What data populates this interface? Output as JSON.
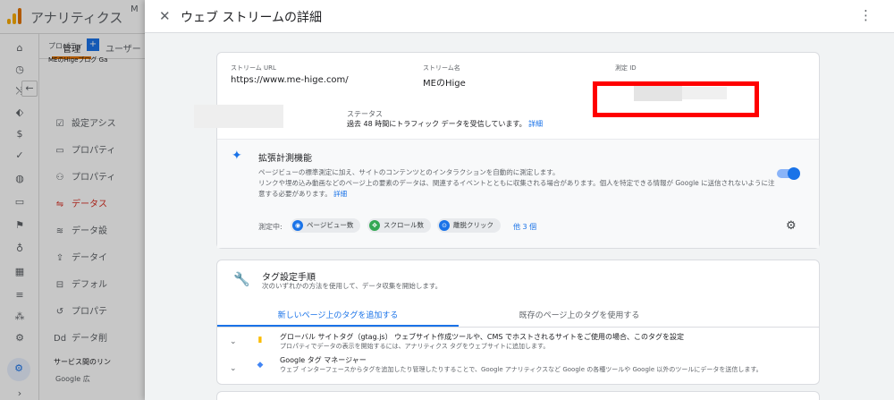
{
  "app": {
    "title": "アナリティクス",
    "account_initial": "M"
  },
  "admin": {
    "tabs": [
      "管理",
      "ユーザー"
    ],
    "property_label": "プロパティ",
    "property_add": "+",
    "property_name": "MEのHigeブログ Ga",
    "items": [
      {
        "icon": "☑",
        "label": "設定アシス"
      },
      {
        "icon": "▭",
        "label": "プロパティ"
      },
      {
        "icon": "⚇",
        "label": "プロパティ"
      },
      {
        "icon": "⇋",
        "label": "データス"
      },
      {
        "icon": "≋",
        "label": "データ設"
      },
      {
        "icon": "⇪",
        "label": "データイ"
      },
      {
        "icon": "⊟",
        "label": "デフォル"
      },
      {
        "icon": "↺",
        "label": "プロパテ"
      },
      {
        "icon": "Dd",
        "label": "データ削"
      }
    ],
    "service_links": "サービス間のリン",
    "service_sub": "Google 広"
  },
  "panel": {
    "title": "ウェブ ストリームの詳細",
    "close_icon": "✕",
    "more_icon": "⋮"
  },
  "stream": {
    "url_label": "ストリーム URL",
    "url": "https://www.me-hige.com/",
    "name_label": "ストリーム名",
    "name": "MEのHige",
    "id_label": "測定 ID",
    "status_label": "ステータス",
    "status_text": "過去 48 時間にトラフィック データを受信しています。",
    "status_link": "詳細"
  },
  "enhanced": {
    "title": "拡張計測機能",
    "desc1": "ページビューの標準測定に加え、サイトのコンテンツとのインタラクションを自動的に測定します。",
    "desc2": "リンクや埋め込み動画などのページ上の要素のデータは、関連するイベントとともに収集される場合があります。個人を特定できる情報が Google に送信されないように注意する必要があります。",
    "desc_link": "詳細",
    "toggle_on": true,
    "measuring_label": "測定中:",
    "chips": [
      {
        "label": "ページビュー数",
        "color": "#1a73e8",
        "icon": "◉"
      },
      {
        "label": "スクロール数",
        "color": "#34a853",
        "icon": "✥"
      },
      {
        "label": "離脱クリック",
        "color": "#1a73e8",
        "icon": "⊙"
      }
    ],
    "more": "他 3 個"
  },
  "tagging": {
    "title": "タグ設定手順",
    "subtitle": "次のいずれかの方法を使用して、データ収集を開始します。",
    "tabs": [
      "新しいページ上のタグを追加する",
      "既存のページ上のタグを使用する"
    ],
    "rows": [
      {
        "title": "グローバル サイトタグ（gtag.js） ウェブサイト作成ツールや、CMS でホストされるサイトをご使用の場合、このタグを設定",
        "desc": "プロパティでデータの表示を開始するには、アナリティクス タグをウェブサイトに追加します。"
      },
      {
        "title": "Google タグ マネージャー",
        "desc": "ウェブ インターフェースからタグを追加したり管理したりすることで、Google アナリティクスなど Google の各種ツールや Google 以外のツールにデータを送信します。"
      }
    ]
  }
}
